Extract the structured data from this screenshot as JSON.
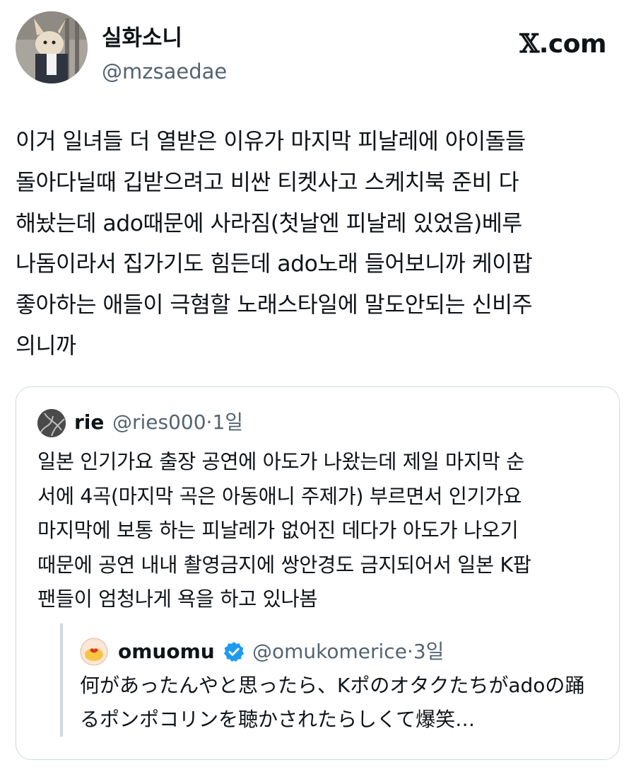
{
  "author": {
    "name": "실화소니",
    "handle": "@mzsaedae"
  },
  "brand": {
    "logo_x": "𝕏",
    "logo_suffix": ".com"
  },
  "tweet": {
    "text": "이거 일녀들 더 열받은 이유가 마지막 피날레에 아이돌들\n돌아다닐때 깁받으려고 비싼 티켓사고 스케치북 준비 다\n해놨는데 ado때문에 사라짐(첫날엔 피날레 있었음)베루\n나돔이라서 집가기도 힘든데 ado노래 들어보니까 케이팝\n좋아하는 애들이 극혐할 노래스타일에 말도안되는 신비주\n의니까"
  },
  "quoted": {
    "name": "rie",
    "handle": "@ries000·1일",
    "text": "일본 인기가요 출장 공연에 아도가 나왔는데 제일 마지막 순\n서에 4곡(마지막 곡은 아동애니 주제가) 부르면서 인기가요\n마지막에 보통 하는 피날레가 없어진 데다가 아도가 나오기\n때문에 공연 내내 촬영금지에 쌍안경도 금지되어서 일본 K팝\n팬들이 엄청나게 욕을 하고 있나봄",
    "nested": {
      "name": "omuomu",
      "handle": "@omukomerice·3일",
      "text": "何があったんやと思ったら、Kポのオタクたちがadoの踊\nるポンポコリンを聴かされたらしくて爆笑…",
      "verified_color": "#1d9bf0"
    }
  }
}
